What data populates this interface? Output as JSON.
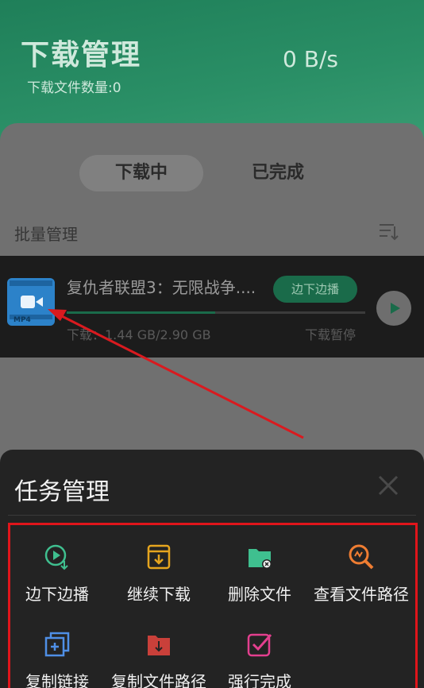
{
  "header": {
    "title": "下载管理",
    "file_count": "下载文件数量:0",
    "speed": "0 B/s"
  },
  "tabs": [
    {
      "label": "下载中",
      "active": true
    },
    {
      "label": "已完成",
      "active": false
    }
  ],
  "batch_label": "批量管理",
  "download": {
    "name": "复仇者联盟3：无限战争....",
    "thumb_format": "MP4",
    "stream_button": "边下边播",
    "size": "下载：1.44 GB/2.90 GB",
    "status": "下载暂停",
    "progress": 0.497
  },
  "task_panel": {
    "title": "任务管理",
    "actions": [
      {
        "label": "边下边播",
        "icon": "play-download-icon",
        "color": "#3fbf8f"
      },
      {
        "label": "继续下载",
        "icon": "resume-download-icon",
        "color": "#e6a51e"
      },
      {
        "label": "删除文件",
        "icon": "delete-folder-icon",
        "color": "#3fbf8f"
      },
      {
        "label": "查看文件路径",
        "icon": "search-path-icon",
        "color": "#ef7d32"
      },
      {
        "label": "复制链接",
        "icon": "copy-link-icon",
        "color": "#4f8fe6"
      },
      {
        "label": "复制文件路径",
        "icon": "copy-path-icon",
        "color": "#c9403a"
      },
      {
        "label": "强行完成",
        "icon": "force-complete-icon",
        "color": "#e33f8e"
      }
    ]
  },
  "colors": {
    "accent_green": "#2a8f66",
    "highlight_red": "#e0151b"
  }
}
